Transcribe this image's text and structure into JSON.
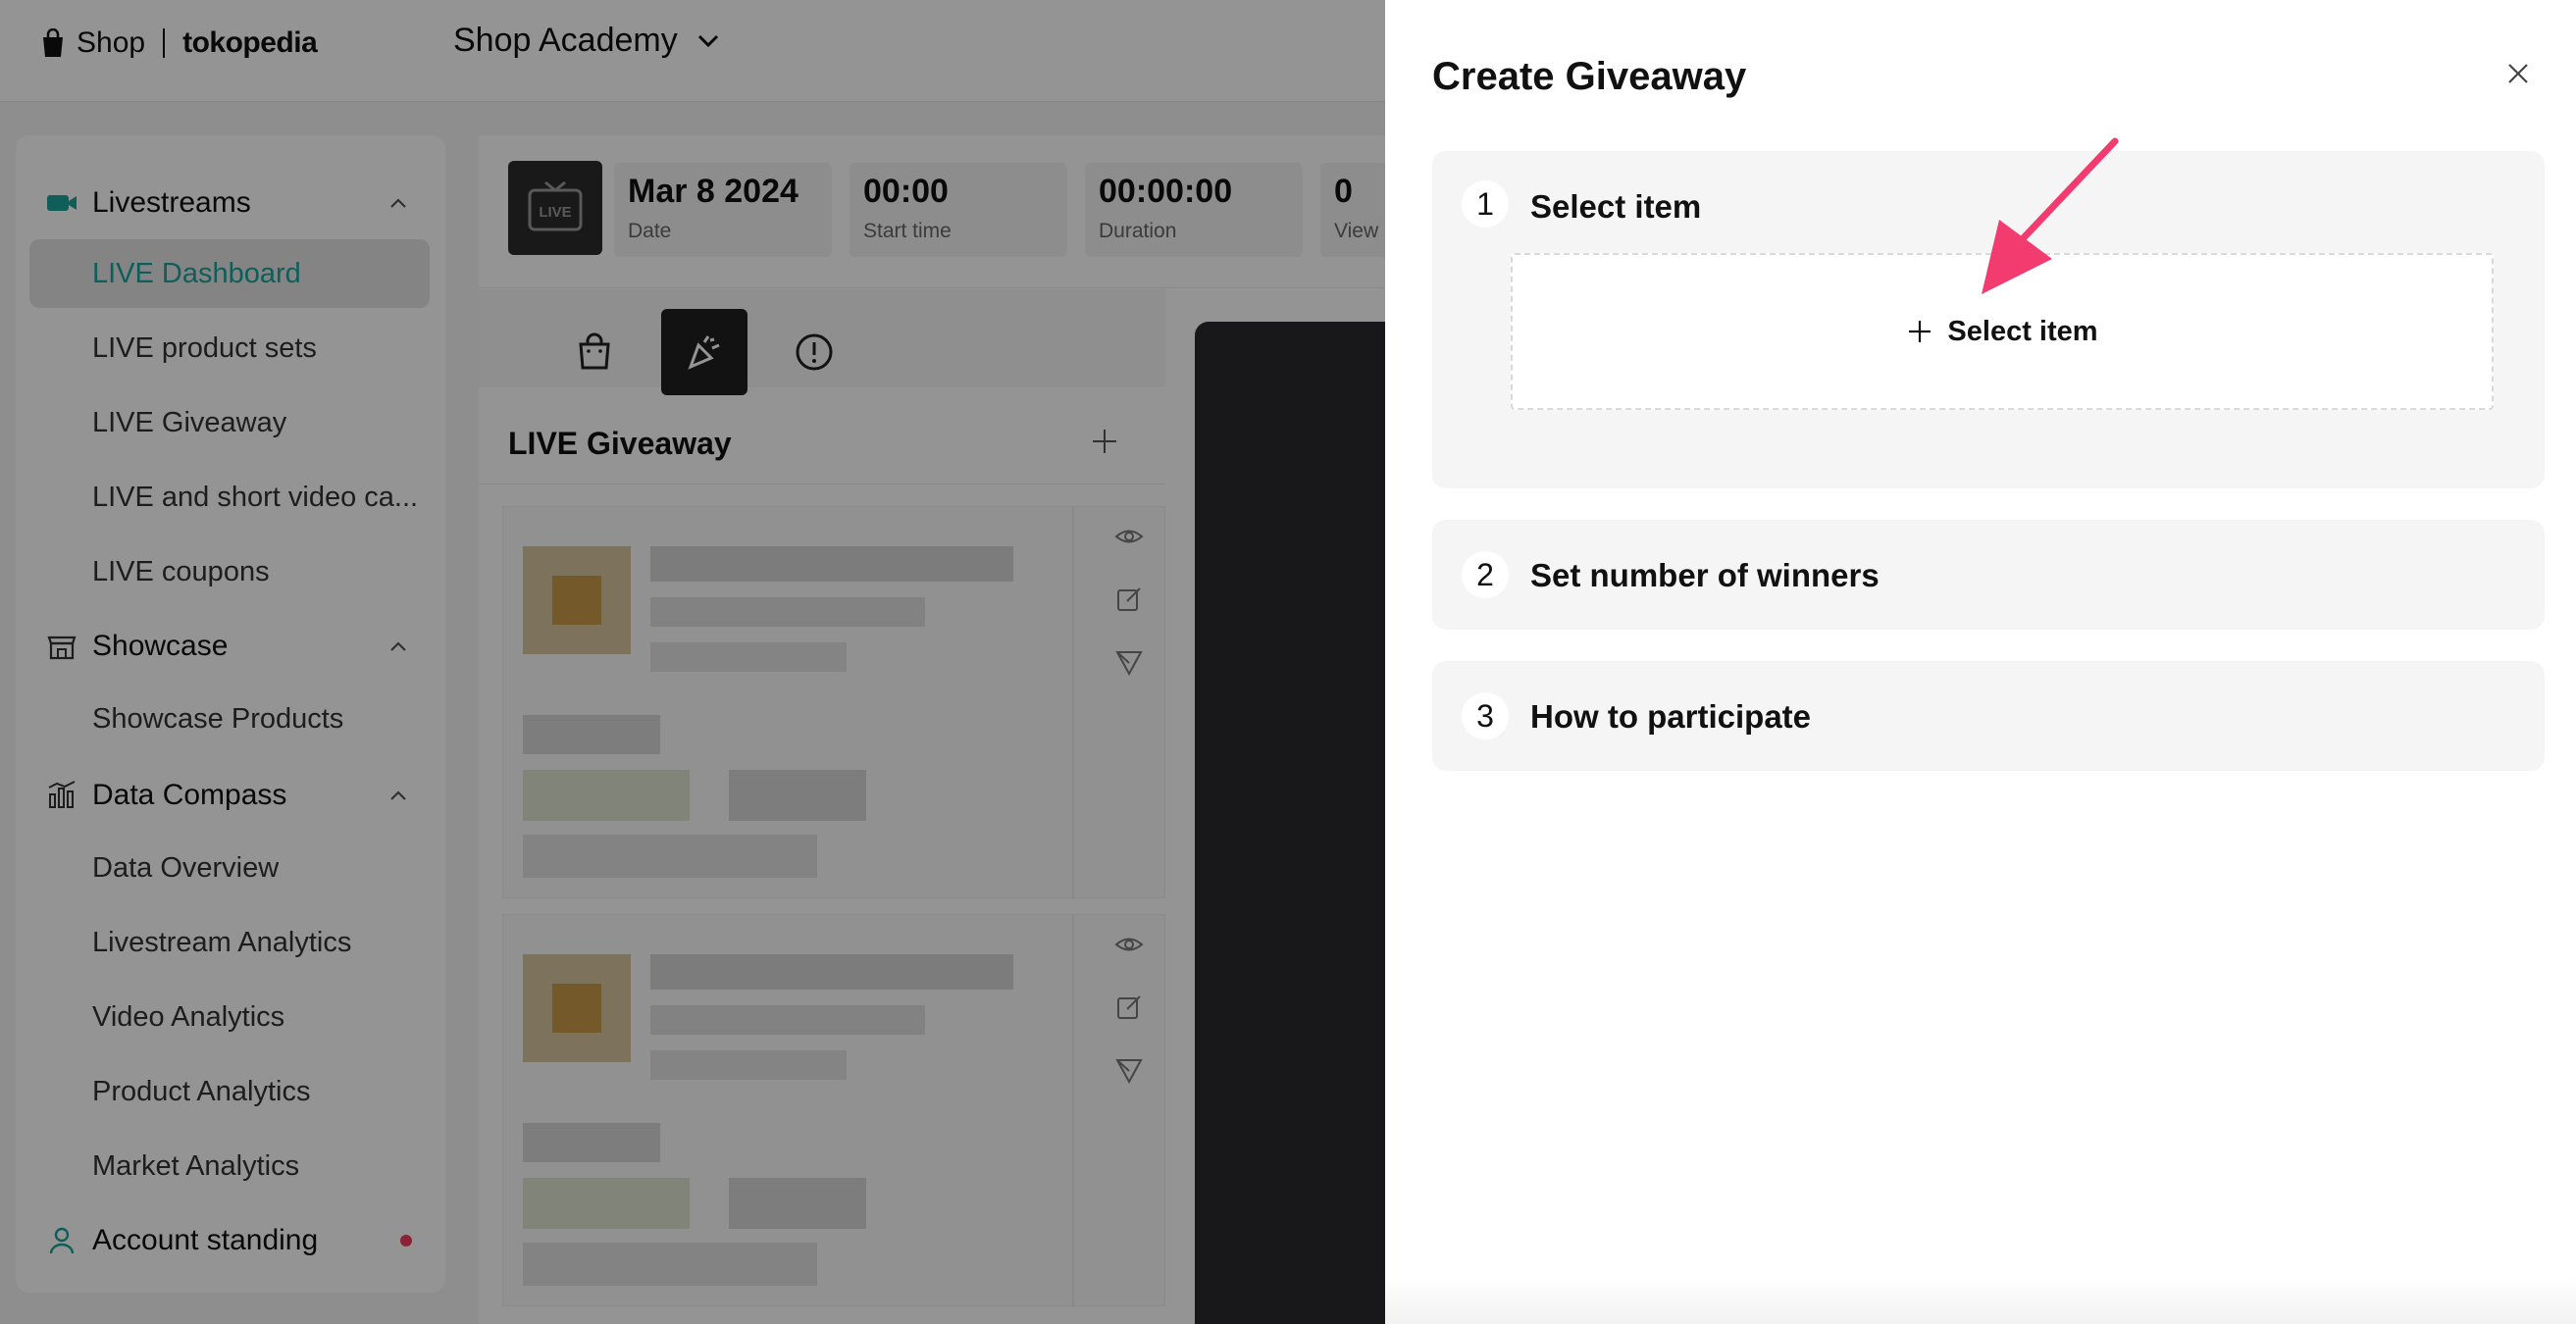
{
  "topbar": {
    "logo_shop": "Shop",
    "logo_partner": "tokopedia",
    "shop_selector": "Shop Academy"
  },
  "sidebar": {
    "sections": [
      {
        "label": "Livestreams",
        "icon": "video-camera-icon",
        "items": [
          "LIVE Dashboard",
          "LIVE product sets",
          "LIVE Giveaway",
          "LIVE and short video ca...",
          "LIVE coupons"
        ]
      },
      {
        "label": "Showcase",
        "icon": "storefront-icon",
        "items": [
          "Showcase Products"
        ]
      },
      {
        "label": "Data Compass",
        "icon": "bar-chart-icon",
        "items": [
          "Data Overview",
          "Livestream Analytics",
          "Video Analytics",
          "Product Analytics",
          "Market Analytics"
        ]
      }
    ],
    "account_standing": "Account standing",
    "active_item": "LIVE Dashboard"
  },
  "main": {
    "live_thumb_label": "LIVE",
    "stats": [
      {
        "value": "Mar 8 2024",
        "label": "Date"
      },
      {
        "value": "00:00",
        "label": "Start time"
      },
      {
        "value": "00:00:00",
        "label": "Duration"
      },
      {
        "value": "0",
        "label": "View"
      }
    ],
    "tools": [
      "shopping-bag-icon",
      "party-popper-icon",
      "alert-circle-icon"
    ],
    "giveaway_title": "LIVE Giveaway"
  },
  "drawer": {
    "title": "Create Giveaway",
    "steps": [
      {
        "number": "1",
        "title": "Select item",
        "action": "Select item"
      },
      {
        "number": "2",
        "title": "Set number of winners"
      },
      {
        "number": "3",
        "title": "How to participate"
      }
    ]
  },
  "colors": {
    "accent_teal": "#1aa39a",
    "annotation_arrow": "#f23b6e",
    "notification_dot": "#f23b5c"
  }
}
